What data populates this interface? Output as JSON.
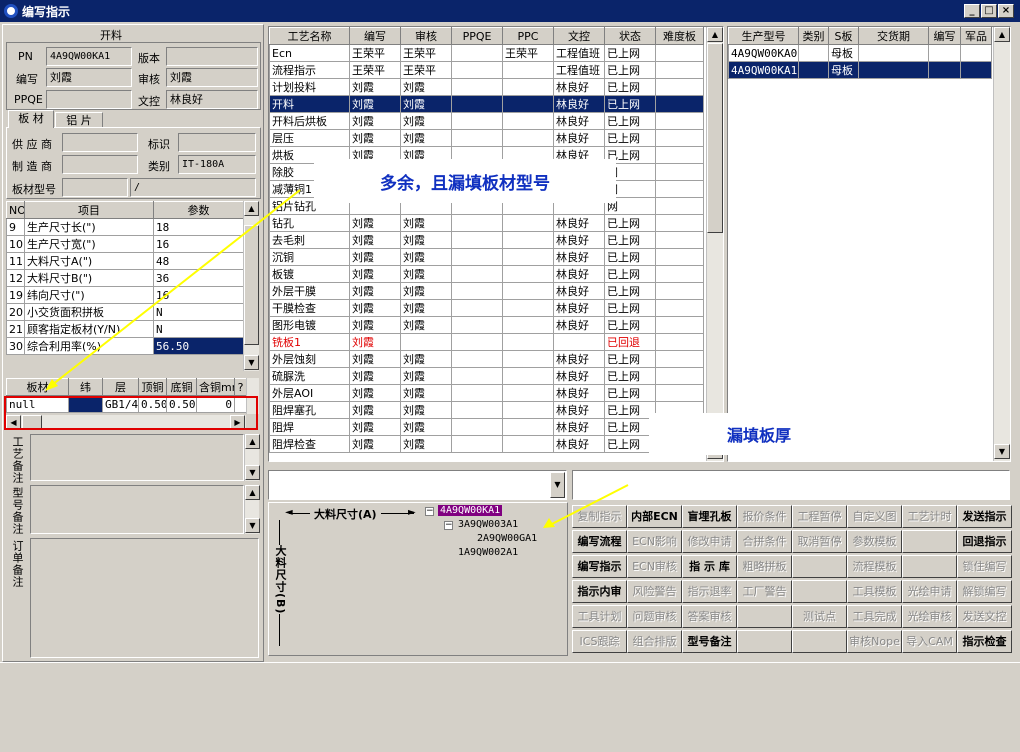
{
  "window": {
    "title": "编写指示",
    "min": "_",
    "max": "□",
    "close": "×"
  },
  "left": {
    "section_title": "开料",
    "pn_label": "PN",
    "pn_value": "4A9QW00KA1",
    "version_label": "版本",
    "version_value": "",
    "writer_label": "编写",
    "writer_value": "刘霞",
    "auditor_label": "审核",
    "auditor_value": "刘霞",
    "ppqe_label": "PPQE",
    "ppqe_value": "",
    "docctl_label": "文控",
    "docctl_value": "林良好",
    "tabs": [
      "板 材",
      "铝 片"
    ],
    "supplier_label": "供 应 商",
    "supplier_value": "",
    "mark_label": "标识",
    "mark_value": "",
    "maker_label": "制 造 商",
    "maker_value": "",
    "category_label": "类别",
    "category_value": "IT-180A",
    "model_label": "板材型号",
    "model_value": "",
    "model_value2": "/",
    "param_headers": [
      "NO",
      "项目",
      "参数"
    ],
    "params": [
      {
        "no": "9",
        "item": "生产尺寸长(\")",
        "val": "18"
      },
      {
        "no": "10",
        "item": "生产尺寸宽(\")",
        "val": "16"
      },
      {
        "no": "11",
        "item": "大料尺寸A(\")",
        "val": "48"
      },
      {
        "no": "12",
        "item": "大料尺寸B(\")",
        "val": "36"
      },
      {
        "no": "19",
        "item": "纬向尺寸(\")",
        "val": "16"
      },
      {
        "no": "20",
        "item": "小交货面积拼板",
        "val": "N"
      },
      {
        "no": "21",
        "item": "顾客指定板材(Y/N)",
        "val": "N"
      },
      {
        "no": "30",
        "item": "综合利用率(%)",
        "val": "56.50"
      }
    ],
    "mat_headers": [
      "板材",
      "纬",
      "层",
      "顶铜",
      "底铜",
      "含铜mm",
      "?"
    ],
    "mat_row": {
      "board": "null",
      "weft": "",
      "layer": "GB1/4",
      "top": "0.50",
      "bottom": "0.50",
      "cu": "0"
    },
    "remark_labels": [
      "工艺备注",
      "型号备注",
      "订单备注"
    ]
  },
  "process": {
    "headers": [
      "工艺名称",
      "编写",
      "审核",
      "PPQE",
      "PPC",
      "文控",
      "状态",
      "难度板"
    ],
    "rows": [
      [
        "Ecn",
        "王荣平",
        "王荣平",
        "",
        "王荣平",
        "工程值班",
        "已上网",
        ""
      ],
      [
        "流程指示",
        "王荣平",
        "王荣平",
        "",
        "",
        "工程值班",
        "已上网",
        ""
      ],
      [
        "计划投料",
        "刘霞",
        "刘霞",
        "",
        "",
        "林良好",
        "已上网",
        ""
      ],
      [
        "开料",
        "刘霞",
        "刘霞",
        "",
        "",
        "林良好",
        "已上网",
        ""
      ],
      [
        "开料后烘板",
        "刘霞",
        "刘霞",
        "",
        "",
        "林良好",
        "已上网",
        ""
      ],
      [
        "层压",
        "刘霞",
        "刘霞",
        "",
        "",
        "林良好",
        "已上网",
        ""
      ],
      [
        "烘板",
        "刘霞",
        "刘霞",
        "",
        "",
        "林良好",
        "已上网",
        ""
      ],
      [
        "除胶",
        "",
        "",
        "",
        "",
        "",
        "网",
        ""
      ],
      [
        "减薄铜1",
        "",
        "",
        "",
        "",
        "",
        "网",
        ""
      ],
      [
        "铝片钻孔",
        "",
        "",
        "",
        "",
        "",
        "网",
        ""
      ],
      [
        "钻孔",
        "刘霞",
        "刘霞",
        "",
        "",
        "林良好",
        "已上网",
        ""
      ],
      [
        "去毛刺",
        "刘霞",
        "刘霞",
        "",
        "",
        "林良好",
        "已上网",
        ""
      ],
      [
        "沉铜",
        "刘霞",
        "刘霞",
        "",
        "",
        "林良好",
        "已上网",
        ""
      ],
      [
        "板镀",
        "刘霞",
        "刘霞",
        "",
        "",
        "林良好",
        "已上网",
        ""
      ],
      [
        "外层干膜",
        "刘霞",
        "刘霞",
        "",
        "",
        "林良好",
        "已上网",
        ""
      ],
      [
        "干膜检查",
        "刘霞",
        "刘霞",
        "",
        "",
        "林良好",
        "已上网",
        ""
      ],
      [
        "图形电镀",
        "刘霞",
        "刘霞",
        "",
        "",
        "林良好",
        "已上网",
        ""
      ],
      [
        "铣板1",
        "刘霞",
        "",
        "",
        "",
        "",
        "已回退",
        ""
      ],
      [
        "外层蚀刻",
        "刘霞",
        "刘霞",
        "",
        "",
        "林良好",
        "已上网",
        ""
      ],
      [
        "硫脲洗",
        "刘霞",
        "刘霞",
        "",
        "",
        "林良好",
        "已上网",
        ""
      ],
      [
        "外层AOI",
        "刘霞",
        "刘霞",
        "",
        "",
        "林良好",
        "已上网",
        ""
      ],
      [
        "阻焊塞孔",
        "刘霞",
        "刘霞",
        "",
        "",
        "林良好",
        "已上网",
        ""
      ],
      [
        "阻焊",
        "刘霞",
        "刘霞",
        "",
        "",
        "林良好",
        "已上网",
        ""
      ],
      [
        "阻焊检查",
        "刘霞",
        "刘霞",
        "",
        "",
        "林良好",
        "已上网",
        ""
      ]
    ]
  },
  "models": {
    "headers": [
      "生产型号",
      "类别",
      "S板",
      "交货期",
      "编写",
      "军品"
    ],
    "rows": [
      [
        "4A9QW00KA0",
        "",
        "母板",
        "",
        "",
        ""
      ],
      [
        "4A9QW00KA1",
        "",
        "母板",
        "",
        "",
        ""
      ]
    ]
  },
  "callouts": {
    "top": "多余，且漏填板材型号",
    "bottom": "漏填板厚"
  },
  "dims": {
    "a_label": "大料尺寸(A)",
    "b_label": "大料尺寸(B)"
  },
  "tree": {
    "root": "4A9QW00KA1",
    "child": "3A9QW003A1",
    "grandchild": "2A9QW00GA1",
    "sibling": "1A9QW002A1"
  },
  "buttons": [
    [
      "复制指示",
      "内部ECN",
      "盲埋孔板",
      "报价条件",
      "工程暂停",
      "自定义图",
      "工艺计时",
      "发送指示"
    ],
    [
      "编写流程",
      "ECN影响",
      "修改申请",
      "合拼条件",
      "取消暂停",
      "参数模板",
      "",
      "回退指示"
    ],
    [
      "编写指示",
      "ECN审核",
      "指 示 库",
      "粗略拼板",
      "",
      "流程模板",
      "",
      "锁住编写"
    ],
    [
      "指示内审",
      "风险警告",
      "指示退率",
      "工厂警告",
      "",
      "工具模板",
      "光绘申请",
      "解锁编写"
    ],
    [
      "工具计划",
      "问题审核",
      "答案审核",
      "",
      "测试点",
      "工具完成",
      "光绘审核",
      "发送文控"
    ],
    [
      "ICS跟踪",
      "组合排版",
      "型号备注",
      "",
      "",
      "审核Nope",
      "导入CAM",
      "指示检查"
    ]
  ],
  "buttons_enabled": [
    [
      0,
      1,
      1,
      0,
      0,
      0,
      0,
      1
    ],
    [
      1,
      0,
      0,
      0,
      0,
      0,
      0,
      1
    ],
    [
      1,
      0,
      1,
      0,
      0,
      0,
      0,
      0
    ],
    [
      1,
      0,
      0,
      0,
      0,
      0,
      0,
      0
    ],
    [
      0,
      0,
      0,
      0,
      0,
      0,
      0,
      0
    ],
    [
      0,
      0,
      1,
      0,
      0,
      0,
      0,
      1
    ]
  ],
  "colors": {
    "titlebar": "#0a246a",
    "selected": "#0a246a",
    "callout_text": "#1030c0",
    "arrow": "#ffff00",
    "highlight_box": "#e00000",
    "tree_root_bg": "#800080"
  }
}
